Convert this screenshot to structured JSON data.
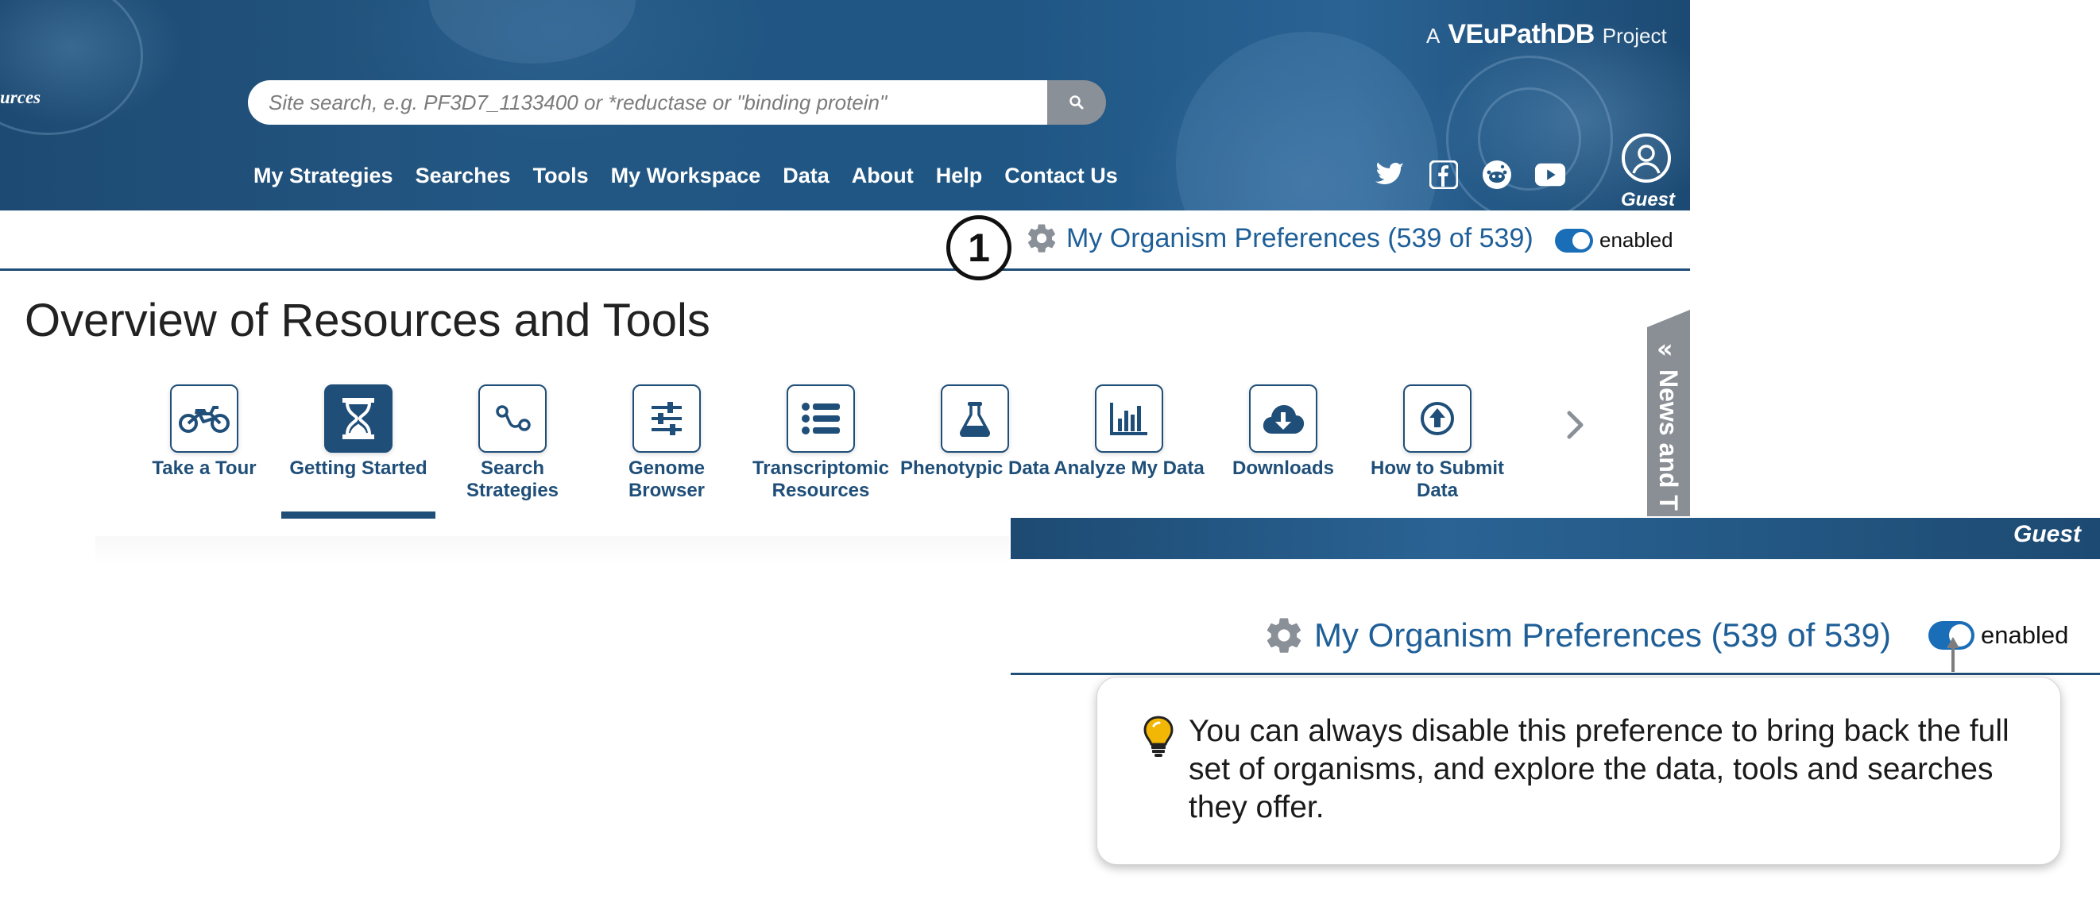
{
  "header": {
    "brand_prefix": "A",
    "brand_name": "VEuPathDB",
    "brand_suffix": "Project",
    "side_label": "urces",
    "search_placeholder": "Site search, e.g. PF3D7_1133400 or *reductase or \"binding protein\"",
    "nav": [
      "My Strategies",
      "Searches",
      "Tools",
      "My Workspace",
      "Data",
      "About",
      "Help",
      "Contact Us"
    ],
    "social_icons": [
      "twitter-icon",
      "facebook-icon",
      "reddit-icon",
      "youtube-icon"
    ],
    "user_label": "Guest"
  },
  "organism_prefs": {
    "label": "My Organism Preferences (539 of 539)",
    "toggle_label": "enabled",
    "toggle_on": true
  },
  "annotation": {
    "step_number": "1"
  },
  "overview": {
    "title": "Overview of Resources and Tools",
    "tools": [
      {
        "label": "Take a Tour",
        "icon": "motorcycle-icon",
        "active": false
      },
      {
        "label": "Getting Started",
        "icon": "hourglass-icon",
        "active": true
      },
      {
        "label": "Search Strategies",
        "icon": "strategy-icon",
        "active": false
      },
      {
        "label": "Genome Browser",
        "icon": "sliders-icon",
        "active": false
      },
      {
        "label": "Transcriptomic Resources",
        "icon": "list-icon",
        "active": false
      },
      {
        "label": "Phenotypic Data",
        "icon": "flask-icon",
        "active": false
      },
      {
        "label": "Analyze My Data",
        "icon": "bar-chart-icon",
        "active": false
      },
      {
        "label": "Downloads",
        "icon": "cloud-download-icon",
        "active": false
      },
      {
        "label": "How to Submit Data",
        "icon": "upload-circle-icon",
        "active": false
      }
    ],
    "news_tab": "News and T"
  },
  "zoom_inset": {
    "user_label": "Guest",
    "pref_label": "My Organism Preferences (539 of 539)",
    "toggle_label": "enabled",
    "tip_text": "You can always disable this preference to bring back the full set of organisms, and explore the data, tools and searches they offer."
  },
  "colors": {
    "banner": "#235783",
    "nav_text": "#ffffff",
    "link_blue": "#1f5f98",
    "tool_navy": "#1f4f79",
    "toggle_blue": "#1a6eb8",
    "tab_gray": "#8a8f95"
  }
}
